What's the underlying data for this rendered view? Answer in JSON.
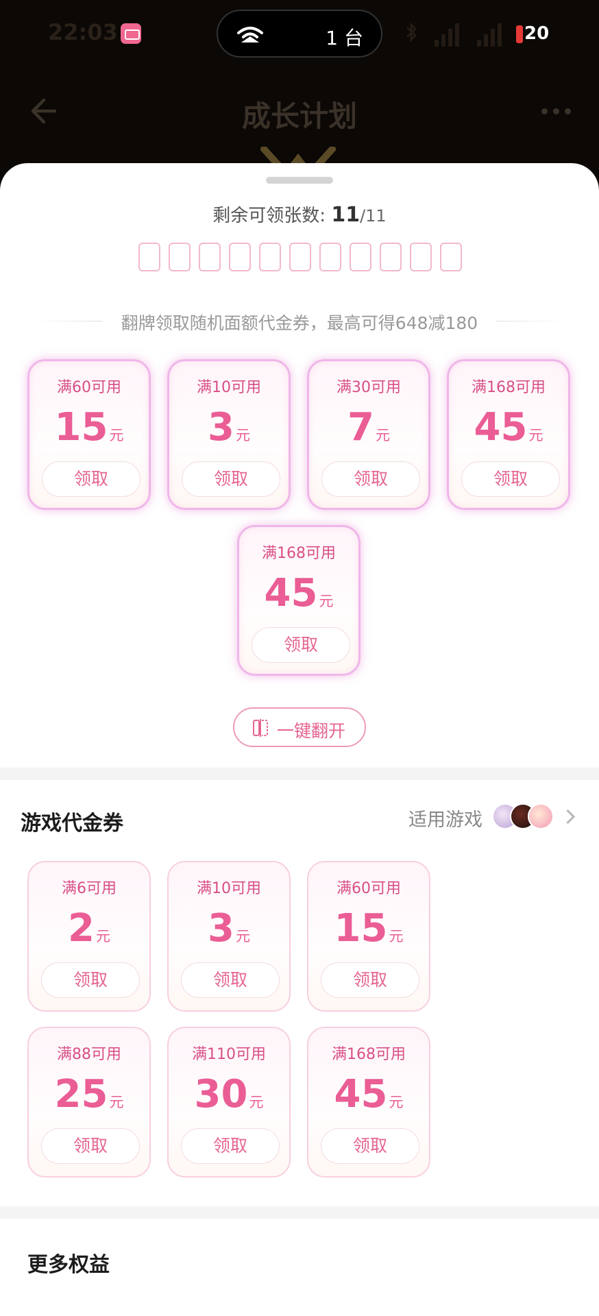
{
  "status_bar": {
    "time": "22:03",
    "island_text": "1 台",
    "battery": "20"
  },
  "nav": {
    "title": "成长计划"
  },
  "flip": {
    "remaining_label": "剩余可领张数: ",
    "remaining_count": "11",
    "remaining_total": "/11",
    "hint": "翻牌领取随机面额代金券，最高可得648减180",
    "cards": [
      {
        "condition": "满60可用",
        "amount": "15",
        "unit": "元",
        "button": "领取"
      },
      {
        "condition": "满10可用",
        "amount": "3",
        "unit": "元",
        "button": "领取"
      },
      {
        "condition": "满30可用",
        "amount": "7",
        "unit": "元",
        "button": "领取"
      },
      {
        "condition": "满168可用",
        "amount": "45",
        "unit": "元",
        "button": "领取"
      },
      {
        "condition": "满168可用",
        "amount": "45",
        "unit": "元",
        "button": "领取"
      }
    ],
    "one_key": "一键翻开"
  },
  "game_vouchers": {
    "title": "游戏代金券",
    "apply_label": "适用游戏",
    "cards": [
      {
        "condition": "满6可用",
        "amount": "2",
        "unit": "元",
        "button": "领取"
      },
      {
        "condition": "满10可用",
        "amount": "3",
        "unit": "元",
        "button": "领取"
      },
      {
        "condition": "满60可用",
        "amount": "15",
        "unit": "元",
        "button": "领取"
      },
      {
        "condition": "满88可用",
        "amount": "25",
        "unit": "元",
        "button": "领取"
      },
      {
        "condition": "满110可用",
        "amount": "30",
        "unit": "元",
        "button": "领取"
      },
      {
        "condition": "满168可用",
        "amount": "45",
        "unit": "元",
        "button": "领取"
      }
    ]
  },
  "more": {
    "title": "更多权益"
  },
  "colors": {
    "accent": "#ea5d95",
    "card_border": "#f8cfe0",
    "glow_border": "#efb6ea"
  }
}
